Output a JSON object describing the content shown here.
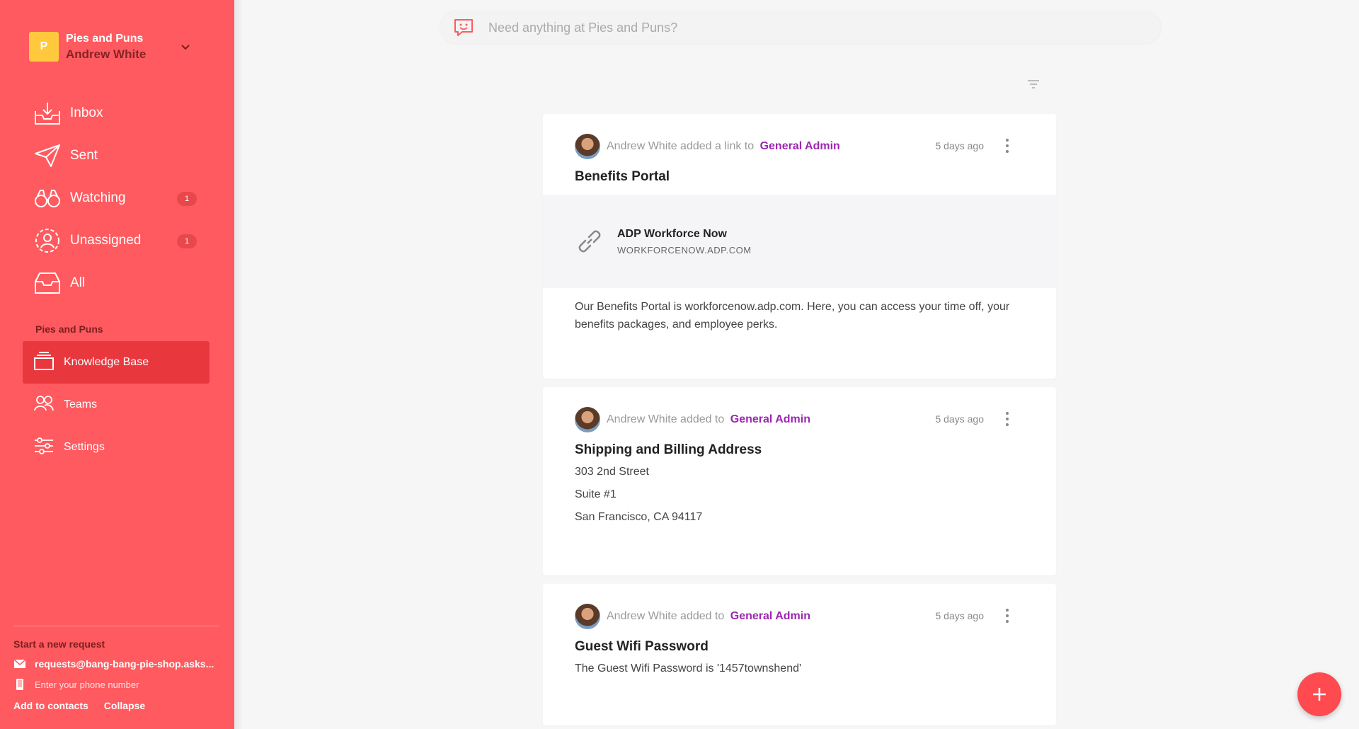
{
  "workspace": {
    "logo_letter": "P",
    "name": "Pies and Puns",
    "user": "Andrew White"
  },
  "nav": {
    "items": [
      {
        "label": "Inbox",
        "icon": "inbox-icon",
        "badge": ""
      },
      {
        "label": "Sent",
        "icon": "paper-plane-icon",
        "badge": ""
      },
      {
        "label": "Watching",
        "icon": "binoculars-icon",
        "badge": "1"
      },
      {
        "label": "Unassigned",
        "icon": "user-circle-icon",
        "badge": "1"
      },
      {
        "label": "All",
        "icon": "tray-icon",
        "badge": ""
      }
    ]
  },
  "section": {
    "title": "Pies and Puns",
    "items": [
      {
        "label": "Knowledge Base",
        "icon": "layers-icon",
        "active": true
      },
      {
        "label": "Teams",
        "icon": "people-icon",
        "active": false
      },
      {
        "label": "Settings",
        "icon": "sliders-icon",
        "active": false
      }
    ]
  },
  "footer": {
    "title": "Start a new request",
    "email": "requests@bang-bang-pie-shop.asks...",
    "phone_placeholder": "Enter your phone number",
    "add_contacts": "Add to contacts",
    "collapse": "Collapse"
  },
  "search": {
    "placeholder": "Need anything at Pies and Puns?"
  },
  "cards": [
    {
      "author": "Andrew White",
      "action": "added a link to",
      "target": "General Admin",
      "time": "5 days ago",
      "title": "Benefits Portal",
      "link_title": "ADP Workforce Now",
      "link_url": "WORKFORCENOW.ADP.COM",
      "body": "Our Benefits Portal is workforcenow.adp.com. Here, you can access your time off, your benefits packages, and employee perks."
    },
    {
      "author": "Andrew White",
      "action": "added to",
      "target": "General Admin",
      "time": "5 days ago",
      "title": "Shipping and Billing Address",
      "lines": [
        "303 2nd Street",
        "Suite #1",
        "San Francisco, CA 94117"
      ]
    },
    {
      "author": "Andrew White",
      "action": "added to",
      "target": "General Admin",
      "time": "5 days ago",
      "title": "Guest Wifi Password",
      "body": "The Guest Wifi Password is '1457townshend'"
    }
  ],
  "colors": {
    "sidebar": "#ff5a5f",
    "accent_purple": "#9c27b0",
    "fab": "#ff4a4f"
  }
}
